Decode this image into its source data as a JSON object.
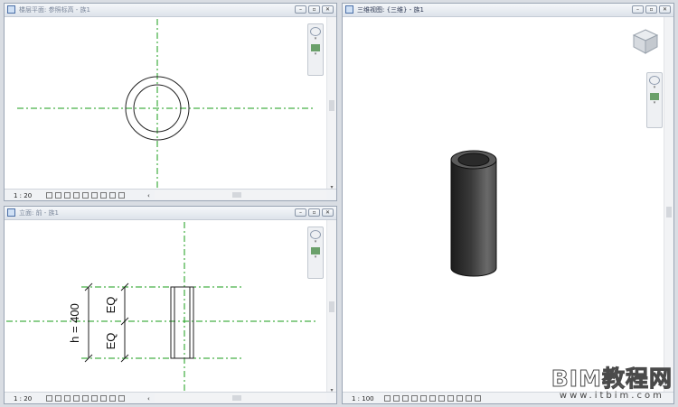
{
  "views": {
    "plan": {
      "title": "楼层平面: 参照标高 - 族1",
      "scale": "1 : 20"
    },
    "elevation": {
      "title": "立面: 前 - 族1",
      "scale": "1 : 20"
    },
    "view3d": {
      "title": "三维视图: {三维} - 族1",
      "scale": "1 : 100"
    }
  },
  "window_buttons": {
    "minimize": "–",
    "restore": "▫",
    "close": "✕"
  },
  "dimensions": {
    "height_label": "h = 400",
    "eq_top": "EQ",
    "eq_bottom": "EQ"
  },
  "scroll_arrow_left": "‹",
  "watermark": {
    "main": "BIM教程网",
    "sub": "www.itbim.com"
  },
  "colors": {
    "ref_line": "#1a9e1a",
    "background": "#ffffff",
    "frame": "#9aa5b4"
  }
}
